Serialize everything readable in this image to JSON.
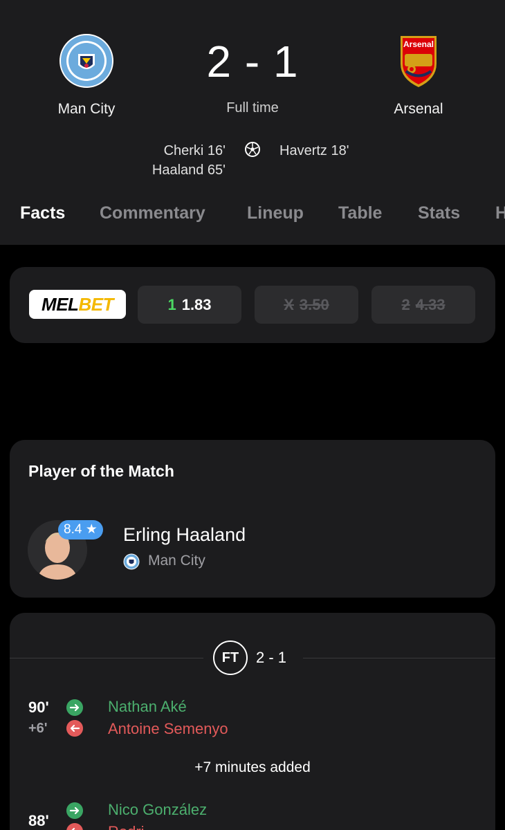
{
  "match": {
    "home_team": "Man City",
    "away_team": "Arsenal",
    "score": "2 - 1",
    "status": "Full time",
    "home_scorers": [
      "Cherki 16'",
      "Haaland 65'"
    ],
    "away_scorers": [
      "Havertz 18'"
    ]
  },
  "tabs": [
    "Facts",
    "Commentary",
    "Lineup",
    "Table",
    "Stats",
    "H"
  ],
  "odds": {
    "brand_left": "MEL",
    "brand_right": "BET",
    "options": [
      {
        "outcome": "1",
        "value": "1.83",
        "disabled": false
      },
      {
        "outcome": "X",
        "value": "3.50",
        "disabled": true
      },
      {
        "outcome": "2",
        "value": "4.33",
        "disabled": true
      }
    ]
  },
  "potm": {
    "title": "Player of the Match",
    "rating": "8.4 ★",
    "player_name": "Erling Haaland",
    "team": "Man City"
  },
  "events": {
    "ft_label": "FT",
    "ft_score": "2 - 1",
    "sub1": {
      "minute": "90'",
      "added": "+6'",
      "player_in": "Nathan Aké",
      "player_out": "Antoine Semenyo"
    },
    "added_time": "+7 minutes added",
    "sub2": {
      "minute": "88'",
      "player_in": "Nico González",
      "player_out": "Rodri"
    }
  },
  "colors": {
    "background": "#000000",
    "card": "#1c1c1e",
    "sub_in": "#4caf6e",
    "sub_out": "#e35a5a",
    "rating_badge": "#4a9df0",
    "odds_highlight": "#4cd964"
  }
}
